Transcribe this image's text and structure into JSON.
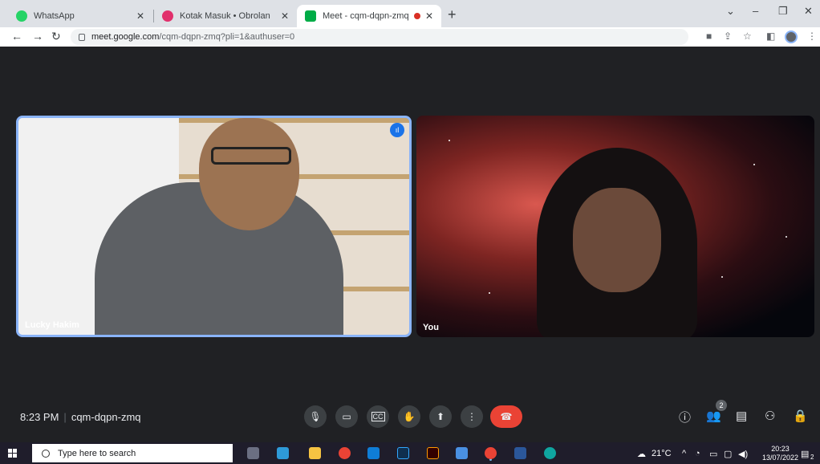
{
  "browser": {
    "tabs": [
      {
        "title": "WhatsApp",
        "icon": "whatsapp-icon",
        "color": "#25d366"
      },
      {
        "title": "Kotak Masuk • Obrolan",
        "icon": "instagram-icon",
        "color": "#e1306c"
      },
      {
        "title": "Meet - cqm-dqpn-zmq",
        "icon": "meet-icon",
        "color": "#00ac47",
        "active": true
      }
    ],
    "url_host": "meet.google.com",
    "url_path": "/cqm-dqpn-zmq?pli=1&authuser=0"
  },
  "meeting": {
    "time": "8:23 PM",
    "code": "cqm-dqpn-zmq",
    "participants": [
      {
        "name": "Lucky Hakim",
        "speaking": true
      },
      {
        "name": "You"
      }
    ],
    "people_count": "2"
  },
  "taskbar": {
    "search_placeholder": "Type here to search",
    "temperature": "21°C",
    "time": "20:23",
    "date": "13/07/2022",
    "notification_count": "2"
  },
  "colors": {
    "accent": "#8ab4f8",
    "end_call": "#ea4335",
    "stage_bg": "#202124"
  }
}
